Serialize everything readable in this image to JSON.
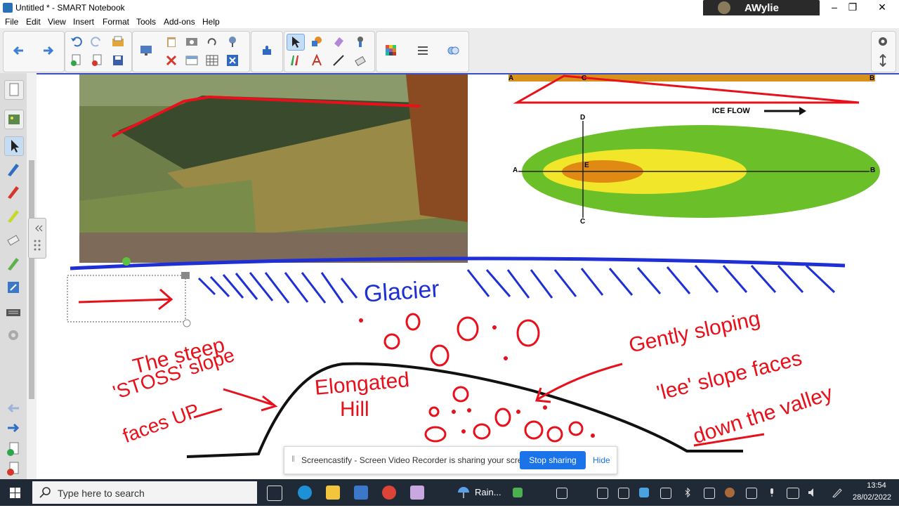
{
  "window": {
    "title": "Untitled * - SMART Notebook",
    "user": "AWylie",
    "controls": [
      "–",
      "❐",
      "✕"
    ]
  },
  "menu": [
    "File",
    "Edit",
    "View",
    "Insert",
    "Format",
    "Tools",
    "Add-ons",
    "Help"
  ],
  "toolbar": {
    "groups": [
      [
        "back-arrow-icon",
        "forward-arrow-icon"
      ],
      [
        "undo-icon",
        "redo-icon",
        "open-file-icon",
        "add-page-icon",
        "delete-page-icon",
        "save-icon"
      ],
      [
        "display-icon",
        "paste-icon",
        "screenshade-icon",
        "capture-icon",
        "delete-x-icon",
        "table-icon",
        "record-icon",
        "doc-camera-icon",
        "redo2-icon",
        "window-x-icon"
      ],
      [
        "addon-puzzle-icon"
      ],
      [
        "select-arrow-icon",
        "shapes-icon",
        "eraser-icon",
        "magic-pen-icon",
        "pens-icon",
        "text-icon",
        "line-icon",
        "fill-eraser-icon"
      ],
      [
        "properties-color-icon",
        "lines-icon",
        "fill-icon"
      ]
    ]
  },
  "canvas": {
    "diagram_labels": {
      "a": "A",
      "b": "B",
      "c": "C",
      "d": "D",
      "e": "E",
      "ice_flow": "ICE FLOW"
    },
    "handwriting": {
      "glacier": "Glacier",
      "steep": "The steep",
      "stoss": "'STOSS' slope",
      "faces_up": "faces UP",
      "elongated": "Elongated",
      "hill": "Hill",
      "gently": "Gently sloping",
      "lee": "'lee' slope faces",
      "down": "down the valley"
    }
  },
  "notification": {
    "text": "Screencastify - Screen Video Recorder is sharing your screen.",
    "stop": "Stop sharing",
    "hide": "Hide"
  },
  "taskbar": {
    "search_placeholder": "Type here to search",
    "weather": "Rain...",
    "time": "13:54",
    "date": "28/02/2022"
  },
  "colors": {
    "glacier_blue": "#1f2fd6",
    "ink_red": "#e8101a",
    "diagram_green": "#6bc02a",
    "diagram_yellow": "#f1e62a",
    "diagram_orange": "#e08a13",
    "stop_button": "#1a73e8",
    "taskbar": "#202936"
  }
}
